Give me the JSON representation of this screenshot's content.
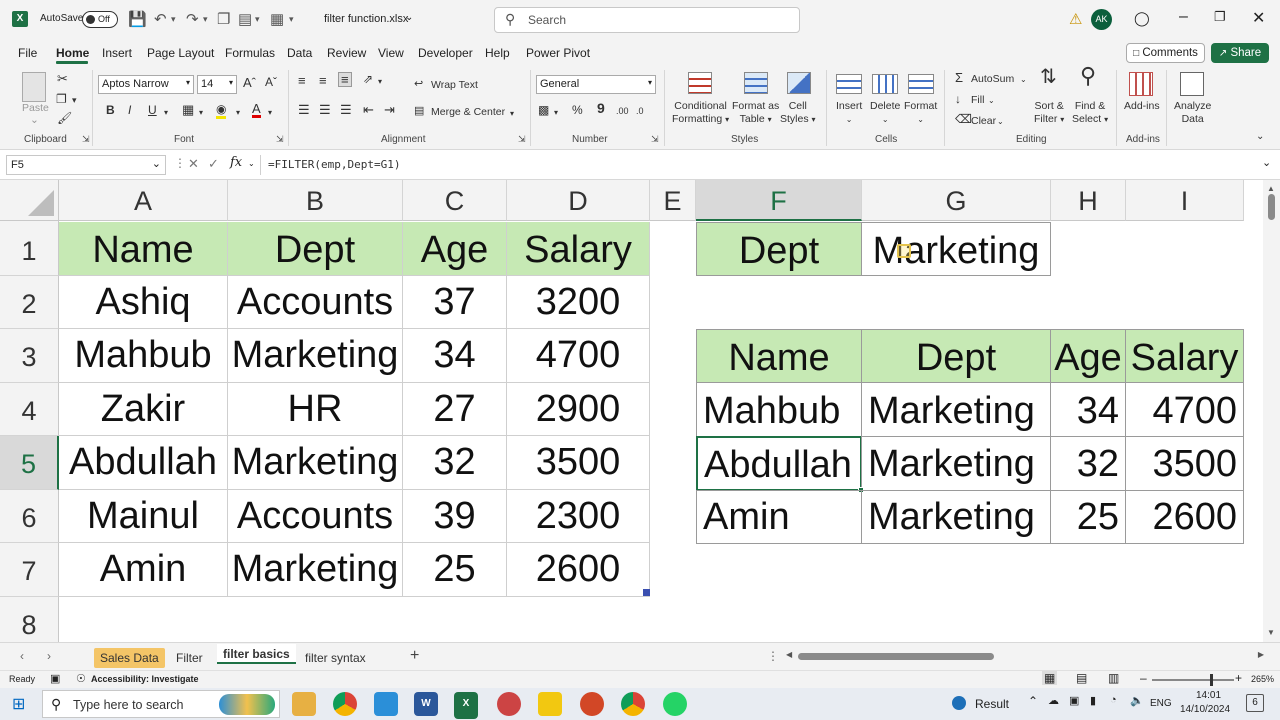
{
  "titlebar": {
    "autosave": "AutoSave",
    "toggle": "Off",
    "filename": "filter function.xlsx",
    "search": "Search",
    "avatar": "AK"
  },
  "menu": [
    "File",
    "Home",
    "Insert",
    "Page Layout",
    "Formulas",
    "Data",
    "Review",
    "View",
    "Developer",
    "Help",
    "Power Pivot"
  ],
  "menu_right": {
    "comments": "Comments",
    "share": "Share"
  },
  "ribbon": {
    "paste": "Paste",
    "font_name": "Aptos Narrow",
    "font_size": "14",
    "wrap": "Wrap Text",
    "merge": "Merge & Center",
    "number_format": "General",
    "cond": "Conditional",
    "cond2": "Formatting",
    "fmt_table": "Format as",
    "fmt_table2": "Table",
    "cell_styles": "Cell",
    "cell_styles2": "Styles",
    "insert": "Insert",
    "delete": "Delete",
    "format": "Format",
    "autosum": "AutoSum",
    "fill": "Fill",
    "clear": "Clear",
    "sort": "Sort &",
    "sort2": "Filter",
    "find": "Find &",
    "find2": "Select",
    "addins": "Add-ins",
    "analyze": "Analyze",
    "analyze2": "Data",
    "groups": {
      "clipboard": "Clipboard",
      "font": "Font",
      "alignment": "Alignment",
      "number": "Number",
      "styles": "Styles",
      "cells": "Cells",
      "editing": "Editing",
      "addins": "Add-ins"
    }
  },
  "formula_bar": {
    "namebox": "F5",
    "formula": "=FILTER(emp,Dept=G1)"
  },
  "columns": [
    "A",
    "B",
    "C",
    "D",
    "E",
    "F",
    "G",
    "H",
    "I"
  ],
  "rows": [
    "1",
    "2",
    "3",
    "4",
    "5",
    "6",
    "7",
    "8"
  ],
  "source_table": {
    "headers": [
      "Name",
      "Dept",
      "Age",
      "Salary"
    ],
    "rows": [
      [
        "Ashiq",
        "Accounts",
        "37",
        "3200"
      ],
      [
        "Mahbub",
        "Marketing",
        "34",
        "4700"
      ],
      [
        "Zakir",
        "HR",
        "27",
        "2900"
      ],
      [
        "Abdullah",
        "Marketing",
        "32",
        "3500"
      ],
      [
        "Mainul",
        "Accounts",
        "39",
        "2300"
      ],
      [
        "Amin",
        "Marketing",
        "25",
        "2600"
      ]
    ]
  },
  "criteria": {
    "label": "Dept",
    "value": "Marketing"
  },
  "result_table": {
    "headers": [
      "Name",
      "Dept",
      "Age",
      "Salary"
    ],
    "rows": [
      [
        "Mahbub",
        "Marketing",
        "34",
        "4700"
      ],
      [
        "Abdullah",
        "Marketing",
        "32",
        "3500"
      ],
      [
        "Amin",
        "Marketing",
        "25",
        "2600"
      ]
    ]
  },
  "sheets": [
    "Sales Data",
    "Filter",
    "filter basics",
    "filter syntax"
  ],
  "status": {
    "ready": "Ready",
    "accessibility": "Accessibility: Investigate",
    "zoom": "265%"
  },
  "taskbar": {
    "search": "Type here to search",
    "result": "Result",
    "lang": "ENG",
    "time": "14:01",
    "date": "14/10/2024",
    "notif": "6"
  },
  "colors": {
    "header_fill": "#c6e9b4",
    "excel_green": "#1e7145",
    "sheet_tab_highlight": "#f4c567"
  }
}
